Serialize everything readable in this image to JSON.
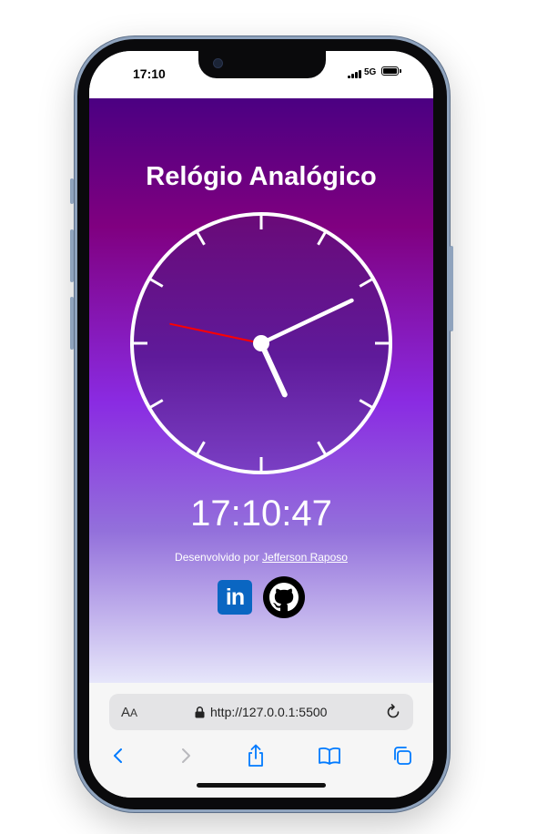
{
  "status_bar": {
    "time": "17:10",
    "network": "5G"
  },
  "page": {
    "title": "Relógio Analógico",
    "digital_time": "17:10:47",
    "credits_prefix": "Desenvolvido por ",
    "author_link": "Jefferson Raposo",
    "linkedin_text": "in",
    "social_icons": [
      "linkedin-icon",
      "github-icon"
    ],
    "clock": {
      "hour": 17,
      "minute": 10,
      "second": 47
    }
  },
  "browser": {
    "text_size_label": "A",
    "text_size_label_small": "A",
    "url": "http://127.0.0.1:5500",
    "icons": [
      "lock-icon",
      "reload-icon",
      "back-icon",
      "forward-icon",
      "share-icon",
      "bookmarks-icon",
      "tabs-icon"
    ]
  },
  "colors": {
    "gradient_top": "#4b0082",
    "gradient_bottom": "#e6e6fa",
    "second_hand": "#ff0000",
    "accent": "#007aff",
    "linkedin": "#0a66c2"
  }
}
